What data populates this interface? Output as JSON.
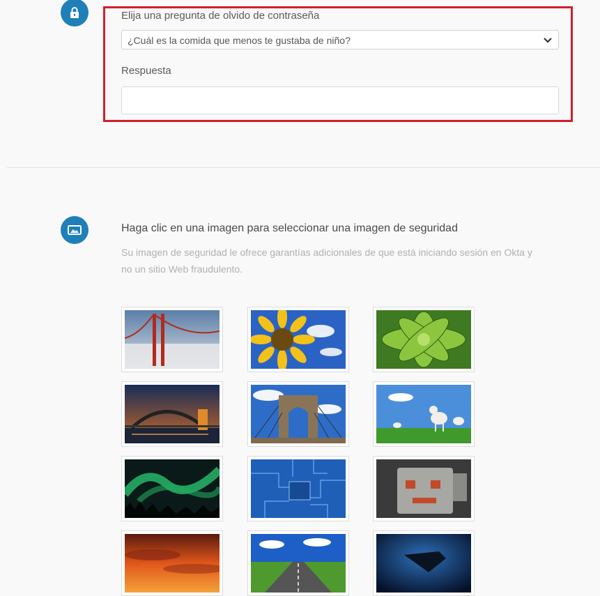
{
  "question_section": {
    "label": "Elija una pregunta de olvido de contraseña",
    "selected_question": "¿Cuál es la comida que menos te gustaba de niño?",
    "answer_label": "Respuesta",
    "answer_value": ""
  },
  "image_section": {
    "title": "Haga clic en una imagen para seleccionar una imagen de seguridad",
    "description": "Su imagen de seguridad le ofrece garantías adicionales de que está iniciando sesión en Okta y no un sitio Web fraudulento.",
    "images": [
      "golden-gate-bridge",
      "sunflower",
      "succulent-plant",
      "harbour-bridge-night",
      "brooklyn-bridge",
      "lambs-on-grass",
      "aurora-borealis",
      "circuit-board",
      "robot-toy",
      "sunset-clouds",
      "road-horizon",
      "manta-ray"
    ]
  },
  "colors": {
    "accent": "#1f7fb8",
    "highlight": "#d0202a"
  }
}
